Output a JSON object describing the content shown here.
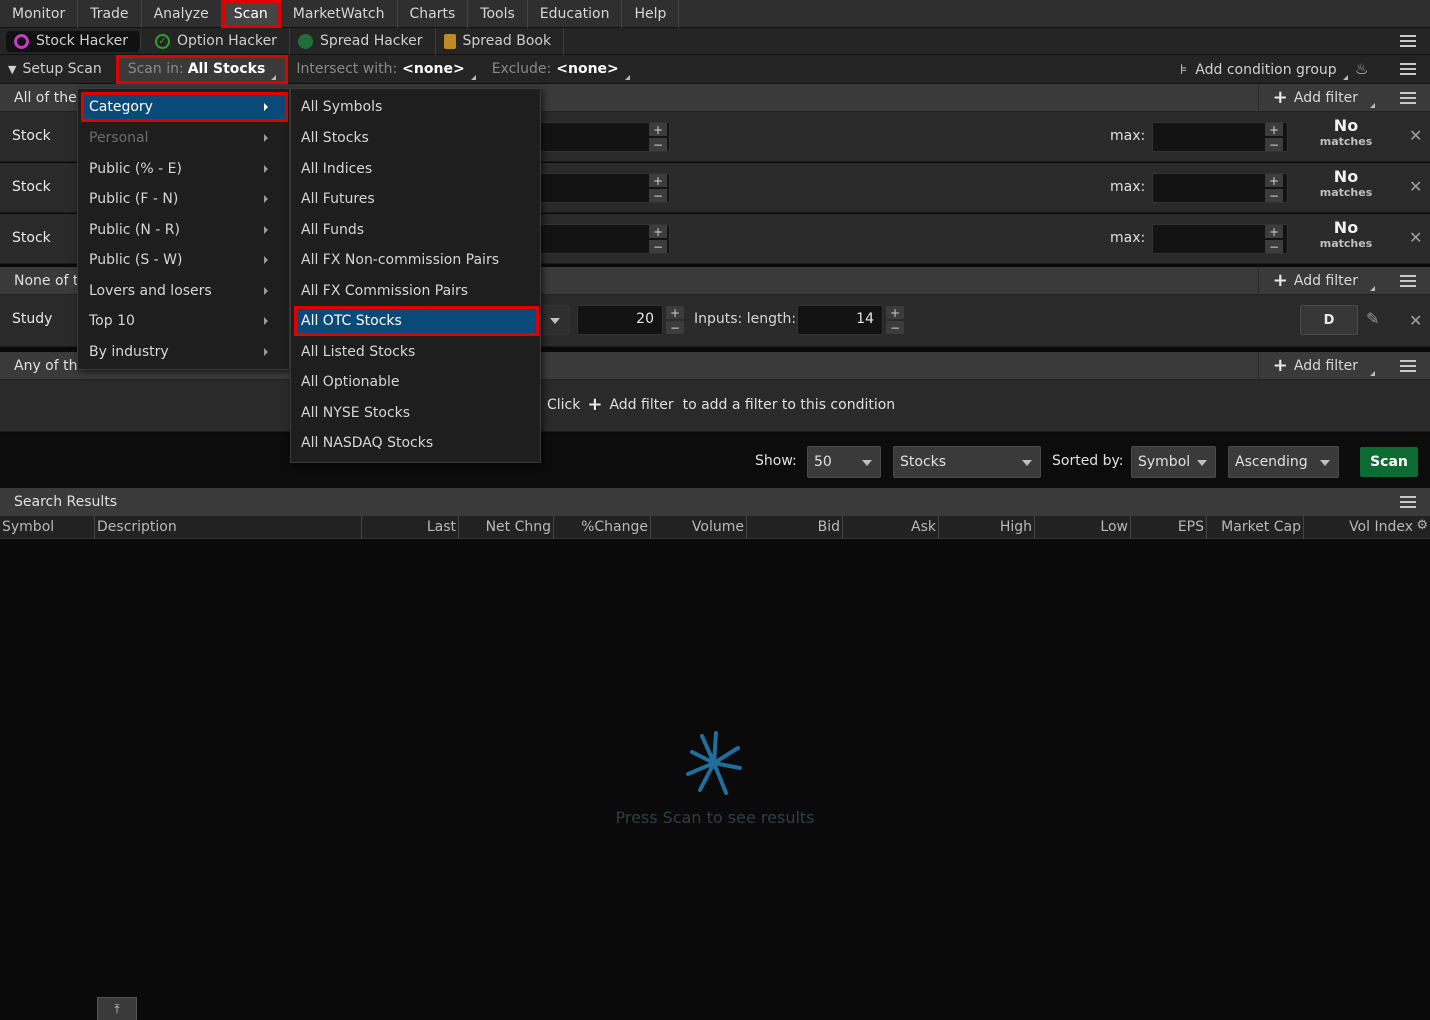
{
  "menubar": {
    "items": [
      "Monitor",
      "Trade",
      "Analyze",
      "Scan",
      "MarketWatch",
      "Charts",
      "Tools",
      "Education",
      "Help"
    ],
    "active": "Scan"
  },
  "subtabs": [
    {
      "label": "Stock Hacker",
      "icon": "stock-hacker-icon",
      "color": "#c040c0"
    },
    {
      "label": "Option Hacker",
      "icon": "option-hacker-icon",
      "color": "#2ea02e"
    },
    {
      "label": "Spread Hacker",
      "icon": "spread-hacker-icon",
      "color": "#1f6e3a"
    },
    {
      "label": "Spread Book",
      "icon": "spread-book-icon",
      "color": "#c08a20"
    }
  ],
  "setup": {
    "setup_label": "Setup Scan",
    "scan_in_label": "Scan in:",
    "scan_in_value": "All Stocks",
    "intersect_label": "Intersect with:",
    "intersect_value": "<none>",
    "exclude_label": "Exclude:",
    "exclude_value": "<none>",
    "add_condition_group": "Add condition group"
  },
  "groups": {
    "all": {
      "label": "All of the",
      "add_filter": "Add filter"
    },
    "none": {
      "label": "None of t",
      "add_filter": "Add filter"
    },
    "any": {
      "label": "Any of the",
      "add_filter": "Add filter"
    }
  },
  "filters": [
    {
      "label": "Stock",
      "max_label": "max:",
      "result_a": "No",
      "result_b": "matches"
    },
    {
      "label": "Stock",
      "max_label": "max:",
      "result_a": "No",
      "result_b": "matches"
    },
    {
      "label": "Stock",
      "max_label": "max:",
      "result_a": "No",
      "result_b": "matches"
    }
  ],
  "study": {
    "label": "Study",
    "value1": "20",
    "inputs_label": "Inputs: length:",
    "value2": "14",
    "aggregation": "D"
  },
  "any_hint": {
    "click": "Click",
    "add_filter": "Add filter",
    "rest": "to add a filter to this condition"
  },
  "controls": {
    "show_label": "Show:",
    "show_value": "50",
    "type_value": "Stocks",
    "sorted_label": "Sorted by:",
    "sorted_value": "Symbol",
    "order_value": "Ascending",
    "scan_button": "Scan"
  },
  "results": {
    "title": "Search Results",
    "columns": [
      "Symbol",
      "Description",
      "Last",
      "Net Chng",
      "%Change",
      "Volume",
      "Bid",
      "Ask",
      "High",
      "Low",
      "EPS",
      "Market Cap",
      "Vol Index"
    ],
    "empty_text": "Press Scan to see results"
  },
  "category_menu": {
    "items": [
      "Category",
      "Personal",
      "Public (% - E)",
      "Public (F - N)",
      "Public (N - R)",
      "Public (S - W)",
      "Lovers and losers",
      "Top 10",
      "By industry"
    ],
    "selected": "Category",
    "disabled": "Personal"
  },
  "symbol_menu": {
    "items": [
      "All Symbols",
      "All Stocks",
      "All Indices",
      "All Futures",
      "All Funds",
      "All FX Non-commission Pairs",
      "All FX Commission Pairs",
      "All OTC Stocks",
      "All Listed Stocks",
      "All Optionable",
      "All NYSE Stocks",
      "All NASDAQ Stocks"
    ],
    "selected": "All OTC Stocks"
  },
  "colors": {
    "highlight_red": "#e00000",
    "selection_blue": "#0a4a78",
    "scan_green": "#0d6b33"
  }
}
